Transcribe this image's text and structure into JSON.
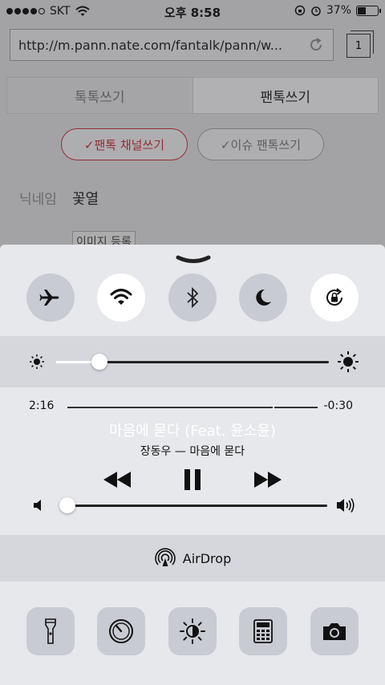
{
  "status_bar": {
    "carrier": "SKT",
    "time": "오후 8:58",
    "battery_text": "37%",
    "battery_level": 0.37,
    "signal_bars": 4
  },
  "browser": {
    "url": "http://m.pann.nate.com/fantalk/pann/w...",
    "tab_count": "1"
  },
  "page": {
    "tabs": [
      {
        "label": "톡톡쓰기"
      },
      {
        "label": "팬톡쓰기"
      }
    ],
    "pill_red": "✓팬톡 채널쓰기",
    "pill_grey": "✓이슈 팬톡쓰기",
    "nickname_label": "닉네임",
    "nickname_value": "꽃열",
    "image_button": "이미지 등록"
  },
  "control_center": {
    "toggles": [
      {
        "name": "airplane-mode",
        "icon": "airplane-icon",
        "on": false
      },
      {
        "name": "wifi",
        "icon": "wifi-icon",
        "on": true
      },
      {
        "name": "bluetooth",
        "icon": "bluetooth-icon",
        "on": false
      },
      {
        "name": "do-not-disturb",
        "icon": "moon-icon",
        "on": false
      },
      {
        "name": "rotation-lock",
        "icon": "rotation-lock-icon",
        "on": true
      }
    ],
    "brightness_level": 0.16,
    "music": {
      "elapsed": "2:16",
      "remaining": "-0:30",
      "progress": 0.82,
      "title": "마음에 묻다 (Feat. 윤소윤)",
      "artist_album": "장동우 — 마음에 묻다"
    },
    "volume_level": 0.03,
    "airdrop_label": "AirDrop",
    "shortcuts": [
      {
        "name": "flashlight",
        "icon": "flashlight-icon"
      },
      {
        "name": "timer",
        "icon": "timer-icon"
      },
      {
        "name": "night-shift",
        "icon": "night-shift-icon"
      },
      {
        "name": "calculator",
        "icon": "calculator-icon"
      },
      {
        "name": "camera",
        "icon": "camera-icon"
      }
    ],
    "colors": {
      "panel": "#e7e8ec",
      "row": "#d6d7dc",
      "button_off": "#c9cbd2",
      "button_on": "#ffffff",
      "accent_red": "#c0303c"
    }
  }
}
